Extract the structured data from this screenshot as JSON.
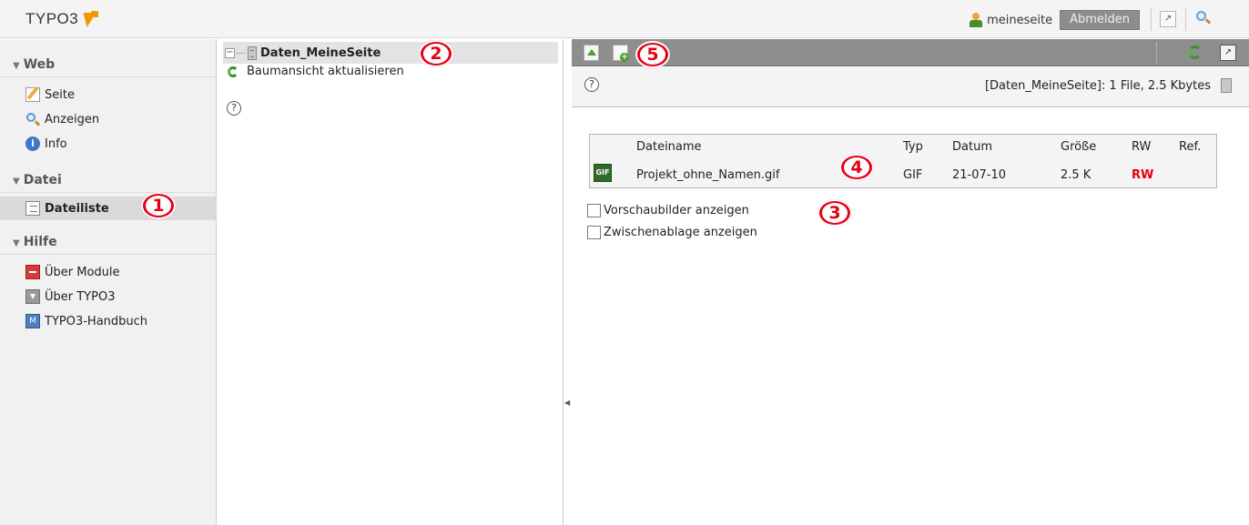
{
  "topbar": {
    "logo_text": "TYPO3",
    "username": "meineseite",
    "logout_label": "Abmelden",
    "shortcut_symbol": "↗",
    "icons": [
      "typo3-logo-icon",
      "user-icon",
      "shortcut-icon",
      "search-icon"
    ]
  },
  "modmenu": {
    "groups": [
      {
        "label": "Web",
        "items": [
          {
            "label": "Seite",
            "icon": "page-edit-icon"
          },
          {
            "label": "Anzeigen",
            "icon": "view-search-icon"
          },
          {
            "label": "Info",
            "icon": "info-icon"
          }
        ]
      },
      {
        "label": "Datei",
        "items": [
          {
            "label": "Dateiliste",
            "icon": "filelist-icon",
            "active": true
          }
        ]
      },
      {
        "label": "Hilfe",
        "items": [
          {
            "label": "Über Module",
            "icon": "about-modules-icon"
          },
          {
            "label": "Über TYPO3",
            "icon": "about-typo3-icon"
          },
          {
            "label": "TYPO3-Handbuch",
            "icon": "manual-icon"
          }
        ]
      }
    ]
  },
  "tree": {
    "root_label": "Daten_MeineSeite",
    "refresh_label": "Baumansicht aktualisieren",
    "help_symbol": "?"
  },
  "content": {
    "folder_info": "[Daten_MeineSeite]: 1 File, 2.5 Kbytes",
    "help_symbol": "?",
    "table": {
      "headers": [
        "Dateiname",
        "Typ",
        "Datum",
        "Größe",
        "RW",
        "Ref."
      ],
      "rows": [
        {
          "name": "Projekt_ohne_Namen.gif",
          "type": "GIF",
          "date": "21-07-10",
          "size": "2.5 K",
          "rw": "RW",
          "ref": "",
          "icon_label": "GIF"
        }
      ]
    },
    "options": [
      {
        "label": "Vorschaubilder anzeigen",
        "checked": false
      },
      {
        "label": "Zwischenablage anzeigen",
        "checked": false
      }
    ]
  },
  "callouts": [
    "1",
    "2",
    "3",
    "4",
    "5"
  ],
  "colors": {
    "callout_red": "#e40015",
    "docheader_gray": "#8e8e8e",
    "rw_red": "#e8000c",
    "logo_orange": "#f49700",
    "active_item_bg": "#dadada"
  }
}
